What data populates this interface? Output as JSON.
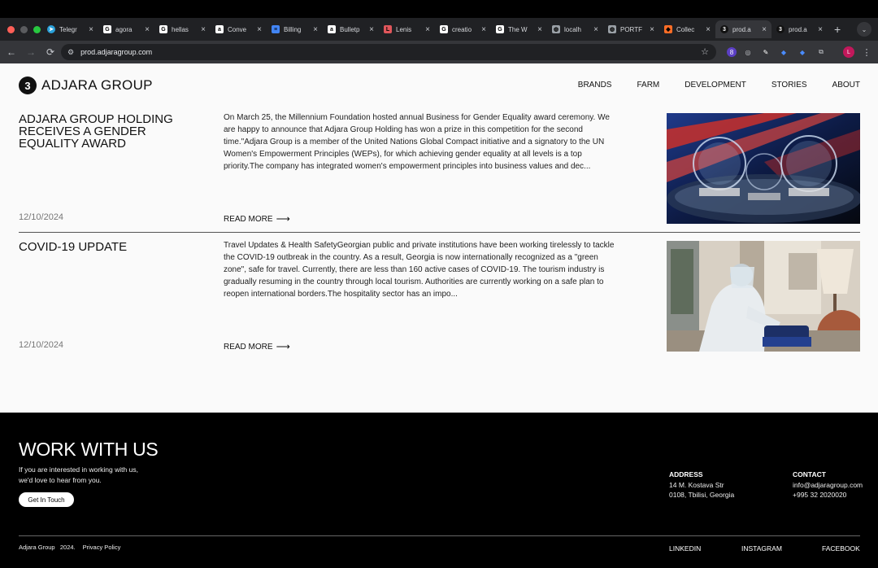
{
  "browser": {
    "window_controls": {
      "close_color": "#ff5f57",
      "minimize_color": "#febc2e",
      "maximize_color": "#28c840"
    },
    "tabs": [
      {
        "title": "Telegr",
        "icon": "telegram-icon",
        "color": "#2aa1da"
      },
      {
        "title": "agora",
        "icon": "google-icon",
        "color": "#ffffff"
      },
      {
        "title": "hellas",
        "icon": "google-icon",
        "color": "#ffffff"
      },
      {
        "title": "Conve",
        "icon": "amazon-icon",
        "color": "#ffffff"
      },
      {
        "title": "Billing",
        "icon": "docs-icon",
        "color": "#4285f4"
      },
      {
        "title": "Bulletp",
        "icon": "amazon-icon",
        "color": "#ffffff"
      },
      {
        "title": "Lenis",
        "icon": "lenis-icon",
        "color": "#e0565b"
      },
      {
        "title": "creatio",
        "icon": "google-icon",
        "color": "#ffffff"
      },
      {
        "title": "The W",
        "icon": "google-icon",
        "color": "#ffffff"
      },
      {
        "title": "localh",
        "icon": "globe-icon",
        "color": "#9aa0a6"
      },
      {
        "title": "PORTF",
        "icon": "globe-icon",
        "color": "#9aa0a6"
      },
      {
        "title": "Collec",
        "icon": "gitlab-icon",
        "color": "#fc6d26"
      },
      {
        "title": "prod.a",
        "icon": "adjara-icon",
        "color": "#111111",
        "active": true
      },
      {
        "title": "prod.a",
        "icon": "adjara-icon",
        "color": "#111111"
      }
    ],
    "url": "prod.adjaragroup.com",
    "profile_initial": "L",
    "extension_badge": "8"
  },
  "site": {
    "logo": "ADJARA GROUP",
    "nav": [
      "BRANDS",
      "FARM",
      "DEVELOPMENT",
      "STORIES",
      "ABOUT"
    ]
  },
  "articles": [
    {
      "title": "ADJARA GROUP HOLDING RECEIVES A GENDER EQUALITY AWARD",
      "body": "On March 25, the Millennium Foundation hosted annual Business for Gender Equality award ceremony. We are happy to announce that Adjara Group Holding has won a prize in this competition for the second time.\"Adjara Group is a member of the United Nations Global Compact initiative and a signatory to the UN Women's Empowerment Principles (WEPs), for which achieving gender equality at all levels is a top priority.The company has integrated women's empowerment principles into business values and dec...",
      "date": "12/10/2024",
      "read_more": "READ MORE"
    },
    {
      "title": "COVID-19 UPDATE",
      "body": "Travel Updates & Health SafetyGeorgian public and private institutions have been working tirelessly to tackle the COVID-19 outbreak in the country. As a result, Georgia is now internationally recognized as a \"green zone\", safe for travel. Currently, there are less than 160 active cases of COVID-19. The tourism industry is gradually resuming in the country through local tourism. Authorities are currently working on a safe plan to reopen international borders.The hospitality sector has an impo...",
      "date": "12/10/2024",
      "read_more": "READ MORE"
    }
  ],
  "footer": {
    "heading": "WORK WITH US",
    "text_line1": "If you are interested in working with us,",
    "text_line2": "we'd love to hear from you.",
    "button": "Get In Touch",
    "address_label": "ADDRESS",
    "address_line1": "14 M. Kostava Str",
    "address_line2": "0108, Tbilisi, Georgia",
    "contact_label": "CONTACT",
    "contact_email": "info@adjaragroup.com",
    "contact_phone": "+995 32 2020020",
    "copyright": "Adjara Group   2024.",
    "privacy": "Privacy Policy",
    "social": [
      "LINKEDIN",
      "INSTAGRAM",
      "FACEBOOK"
    ]
  }
}
